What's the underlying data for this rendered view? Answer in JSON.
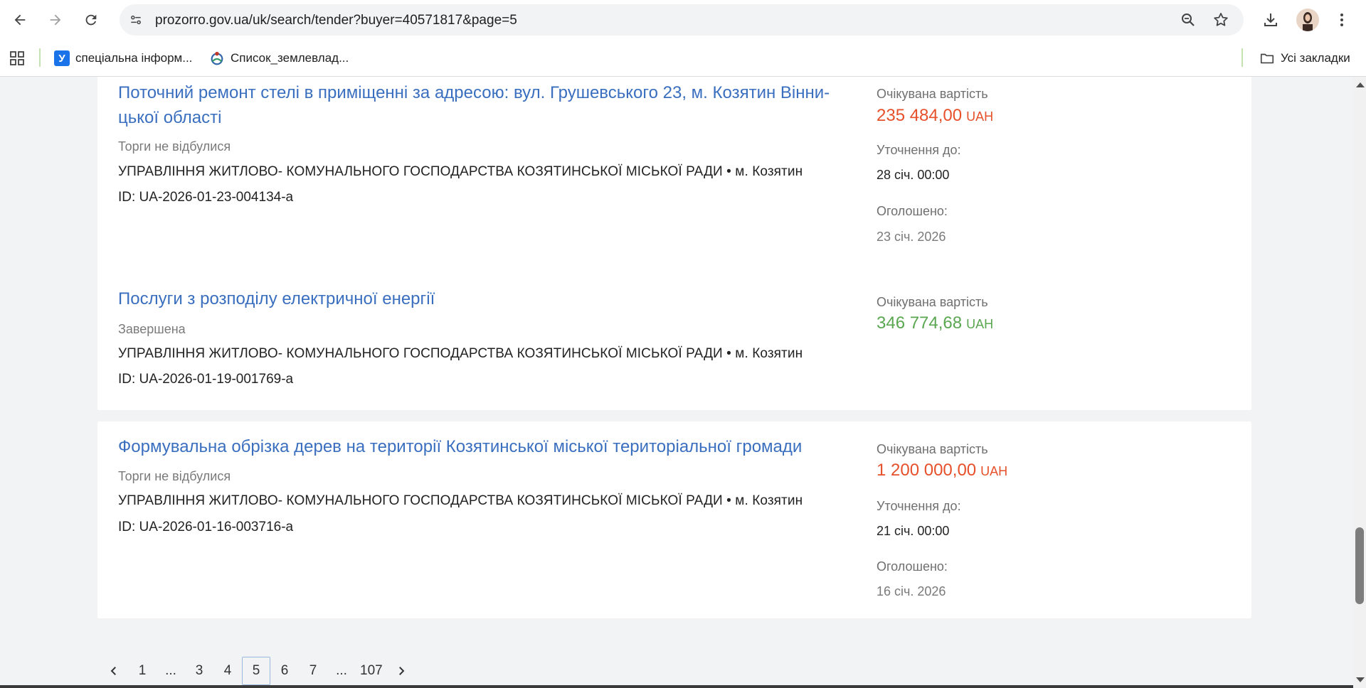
{
  "browser": {
    "url": "prozorro.gov.ua/uk/search/tender?buyer=40571817&page=5",
    "bookmarks": [
      {
        "label": "спеціальна інформ...",
        "icon": "ukrainian-u-favicon"
      },
      {
        "label": "Список_землевлад...",
        "icon": "wikimedia-favicon"
      }
    ],
    "all_bookmarks_label": "Усі закладки"
  },
  "tenders": [
    {
      "title": "Поточний ремонт стелі в приміщенні за адресою: вул. Грушевського 23, м. Козятин Вінницької області",
      "title_line1": "Поточний ремонт стелі в приміщенні за адресою: вул. Грушевського 23, м. Козятин Вінни-",
      "title_line2": "цької області",
      "status": "Торги не відбулися",
      "buyer": "УПРАВЛІННЯ ЖИТЛОВО- КОМУНАЛЬНОГО ГОСПОДАРСТВА КОЗЯТИНСЬКОЇ МІСЬКОЇ РАДИ • м. Козятин",
      "id": "ID: UA-2026-01-23-004134-a",
      "expected_label": "Очікувана вартість",
      "price": "235 484,00",
      "currency": "UAH",
      "price_color": "#e6502a",
      "clarify_label": "Уточнення до:",
      "clarify_value": "28 січ. 00:00",
      "announced_label": "Оголошено:",
      "announced_value": "23 січ. 2026"
    },
    {
      "title": "Послуги з розподілу електричної енергії",
      "status": "Завершена",
      "buyer": "УПРАВЛІННЯ ЖИТЛОВО- КОМУНАЛЬНОГО ГОСПОДАРСТВА КОЗЯТИНСЬКОЇ МІСЬКОЇ РАДИ • м. Козятин",
      "id": "ID: UA-2026-01-19-001769-a",
      "expected_label": "Очікувана вартість",
      "price": "346 774,68",
      "currency": "UAH",
      "price_color": "#5aa651"
    },
    {
      "title": "Формувальна обрізка дерев на території Козятинської міської територіальної громади",
      "status": "Торги не відбулися",
      "buyer": "УПРАВЛІННЯ ЖИТЛОВО- КОМУНАЛЬНОГО ГОСПОДАРСТВА КОЗЯТИНСЬКОЇ МІСЬКОЇ РАДИ • м. Козятин",
      "id": "ID: UA-2026-01-16-003716-a",
      "expected_label": "Очікувана вартість",
      "price": "1 200 000,00",
      "currency": "UAH",
      "price_color": "#e6502a",
      "clarify_label": "Уточнення до:",
      "clarify_value": "21 січ. 00:00",
      "announced_label": "Оголошено:",
      "announced_value": "16 січ. 2026"
    }
  ],
  "pagination": {
    "pages": [
      "1",
      "...",
      "3",
      "4",
      "5",
      "6",
      "7",
      "...",
      "107"
    ],
    "current": "5"
  }
}
